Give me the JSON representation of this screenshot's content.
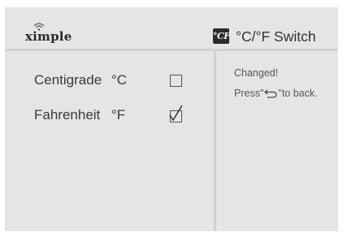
{
  "brand": {
    "logo_text": "ximple",
    "logo_icon": "wifi-signal-icon"
  },
  "header": {
    "title_icon": "celsius-fahrenheit-icon",
    "title_icon_text": "°CF",
    "title": "°C/°F Switch"
  },
  "options": [
    {
      "label": "Centigrade",
      "unit": "°C",
      "checked": false
    },
    {
      "label": "Fahrenheit",
      "unit": "°F",
      "checked": true
    }
  ],
  "message": {
    "line1": "Changed!",
    "line2_prefix": "Press\"",
    "back_icon": "back-arrow-icon",
    "line2_suffix": "\"to back."
  },
  "colors": {
    "screen_bg": "#e5e5e5",
    "divider": "#d2d2d2",
    "text": "#3a3a3a"
  }
}
